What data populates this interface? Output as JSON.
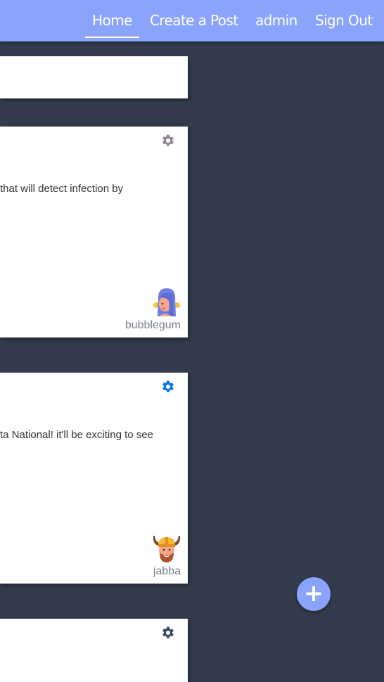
{
  "nav": {
    "home": "Home",
    "create_post": "Create a Post",
    "user": "admin",
    "sign_out": "Sign Out"
  },
  "posts": [
    {},
    {
      "text": "that will detect infection by",
      "author": "bubblegum",
      "gear_color": "#8d8591",
      "avatar_icon": "woman-avatar-icon"
    },
    {
      "text": "ta National! it'll be exciting to see",
      "author": "jabba",
      "gear_color": "#0a73e8",
      "avatar_icon": "viking-avatar-icon"
    },
    {
      "gear_color": "#3d4a63"
    }
  ],
  "fab": {
    "icon": "plus-icon",
    "symbol": "+"
  },
  "colors": {
    "navbar": "#8ba4fb",
    "background": "#333b4d",
    "card": "#ffffff"
  }
}
